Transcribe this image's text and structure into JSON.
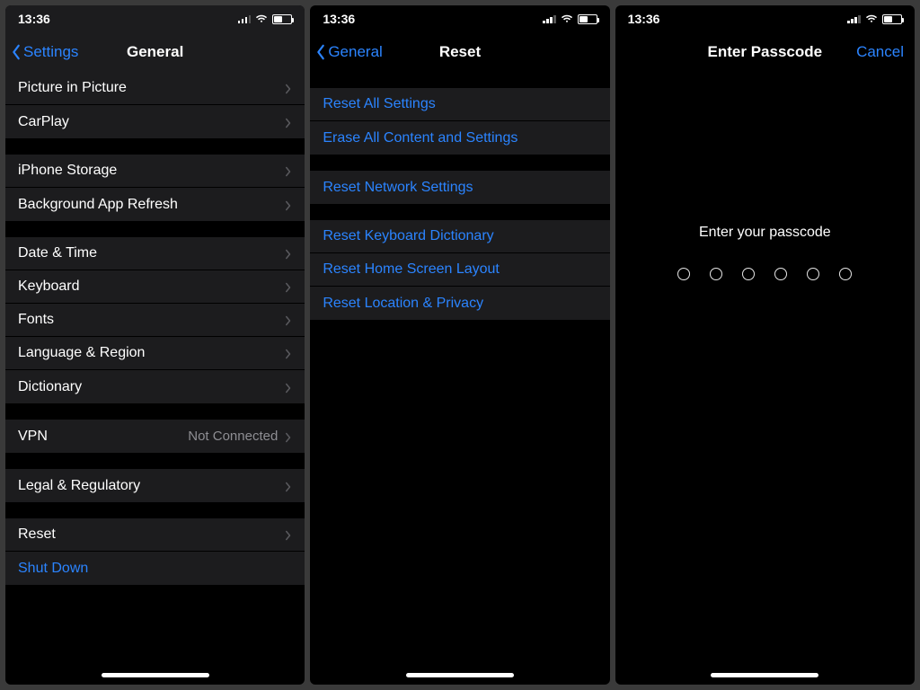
{
  "status": {
    "time": "13:36"
  },
  "screen1": {
    "nav": {
      "back": "Settings",
      "title": "General"
    },
    "groups": [
      {
        "items": [
          {
            "label": "Picture in Picture"
          },
          {
            "label": "CarPlay"
          }
        ]
      },
      {
        "items": [
          {
            "label": "iPhone Storage"
          },
          {
            "label": "Background App Refresh"
          }
        ]
      },
      {
        "items": [
          {
            "label": "Date & Time"
          },
          {
            "label": "Keyboard"
          },
          {
            "label": "Fonts"
          },
          {
            "label": "Language & Region"
          },
          {
            "label": "Dictionary"
          }
        ]
      },
      {
        "items": [
          {
            "label": "VPN",
            "detail": "Not Connected"
          }
        ]
      },
      {
        "items": [
          {
            "label": "Legal & Regulatory"
          }
        ]
      },
      {
        "items": [
          {
            "label": "Reset"
          },
          {
            "label": "Shut Down",
            "blue": true,
            "no_chevron": true
          }
        ]
      }
    ]
  },
  "screen2": {
    "nav": {
      "back": "General",
      "title": "Reset"
    },
    "groups": [
      {
        "items": [
          {
            "label": "Reset All Settings"
          },
          {
            "label": "Erase All Content and Settings"
          }
        ]
      },
      {
        "items": [
          {
            "label": "Reset Network Settings"
          }
        ]
      },
      {
        "items": [
          {
            "label": "Reset Keyboard Dictionary"
          },
          {
            "label": "Reset Home Screen Layout"
          },
          {
            "label": "Reset Location & Privacy"
          }
        ]
      }
    ]
  },
  "screen3": {
    "nav": {
      "title": "Enter Passcode",
      "action": "Cancel"
    },
    "prompt": "Enter your passcode",
    "digits": 6
  }
}
